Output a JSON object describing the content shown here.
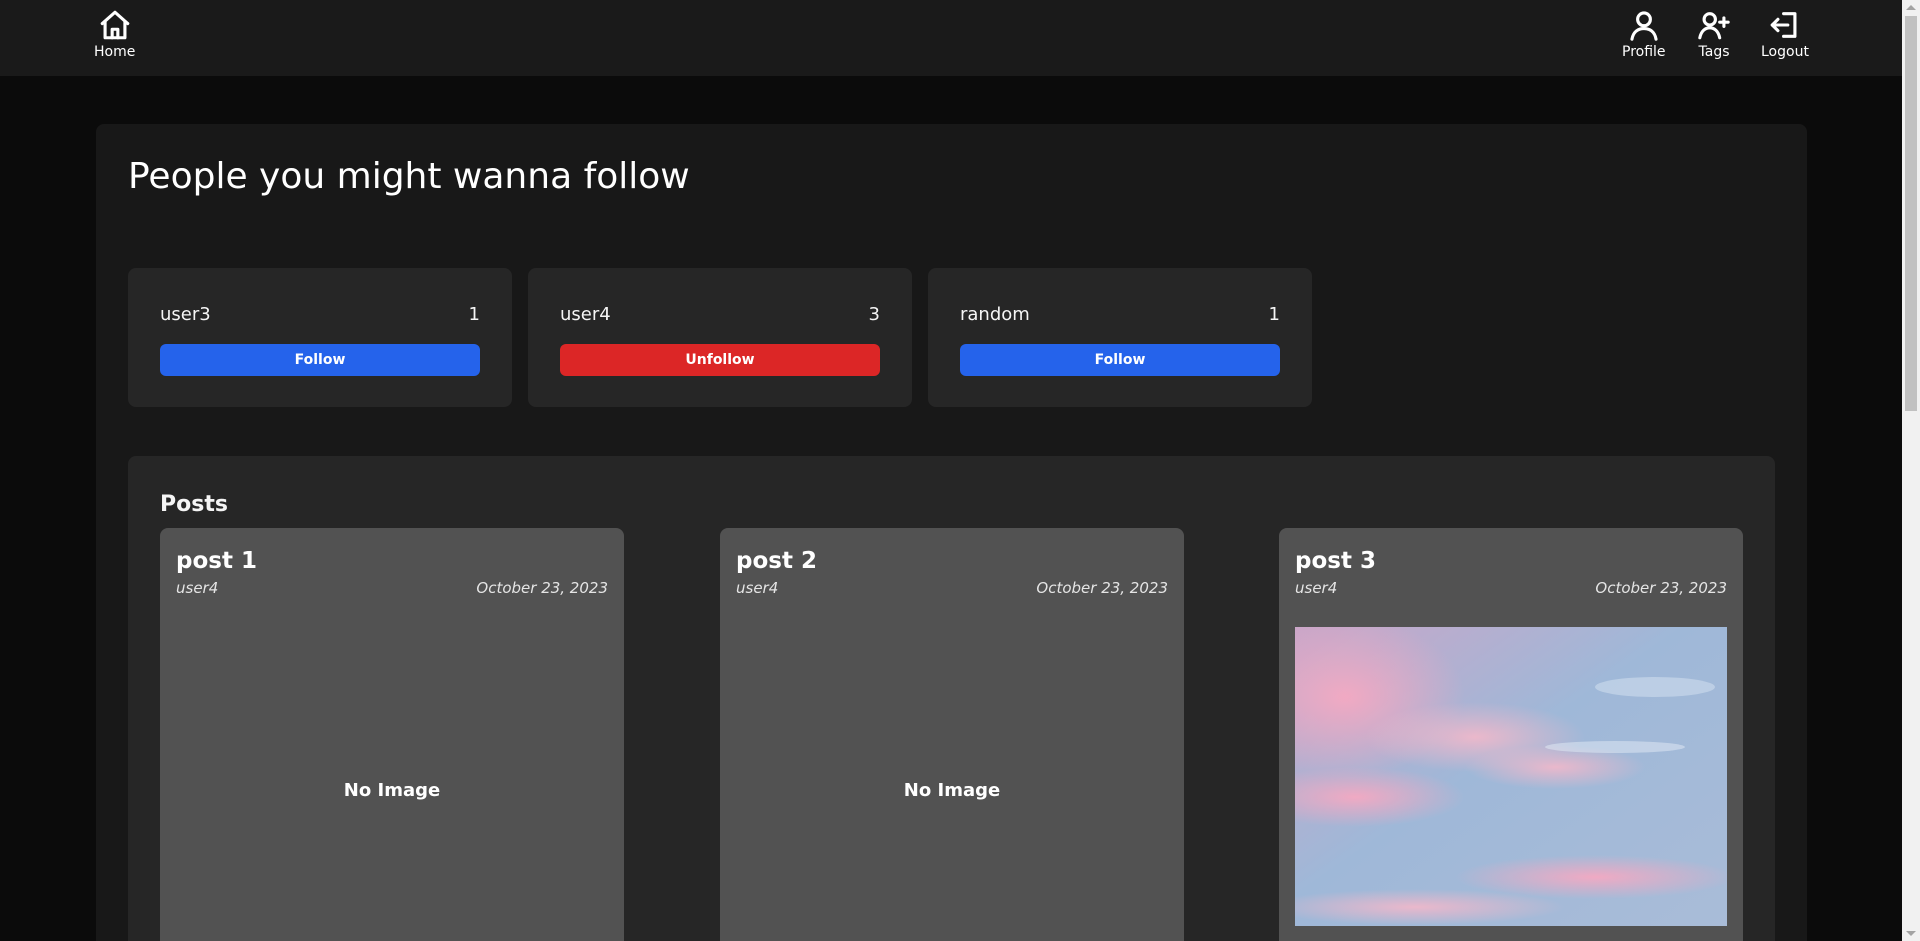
{
  "nav": {
    "home_label": "Home",
    "profile_label": "Profile",
    "tags_label": "Tags",
    "logout_label": "Logout"
  },
  "page_title": "People you might wanna follow",
  "suggestions": [
    {
      "username": "user3",
      "count": "1",
      "button_label": "Follow",
      "button_type": "follow"
    },
    {
      "username": "user4",
      "count": "3",
      "button_label": "Unfollow",
      "button_type": "unfollow"
    },
    {
      "username": "random",
      "count": "1",
      "button_label": "Follow",
      "button_type": "follow"
    }
  ],
  "posts_section": {
    "title": "Posts",
    "posts": [
      {
        "title": "post 1",
        "author": "user4",
        "date": "October 23, 2023",
        "image_placeholder": "No Image"
      },
      {
        "title": "post 2",
        "author": "user4",
        "date": "October 23, 2023",
        "image_placeholder": "No Image"
      },
      {
        "title": "post 3",
        "author": "user4",
        "date": "October 23, 2023"
      }
    ]
  },
  "colors": {
    "follow_button": "#2563eb",
    "unfollow_button": "#dc2626",
    "background": "#0b0b0b",
    "card": "#262626",
    "post_card": "#525252"
  },
  "icons": {
    "home": "home-icon",
    "profile": "user-icon",
    "tags": "user-plus-icon",
    "logout": "logout-icon"
  }
}
